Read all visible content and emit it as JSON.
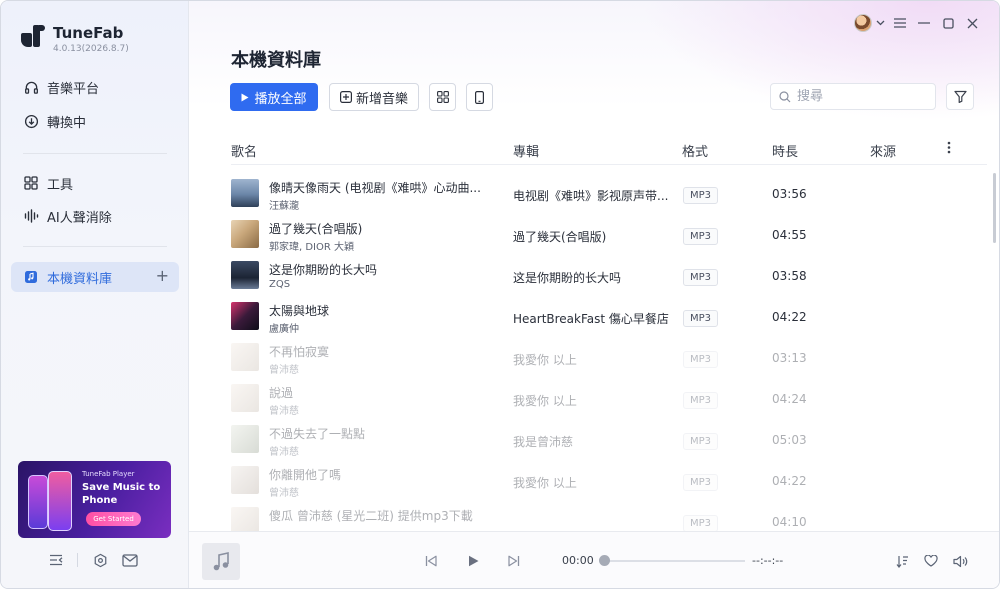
{
  "app": {
    "name": "TuneFab",
    "version": "4.0.13(2026.8.7)"
  },
  "sidebar": {
    "items": [
      {
        "label": "音樂平台",
        "icon": "headphones-icon"
      },
      {
        "label": "轉換中",
        "icon": "download-circle-icon"
      },
      {
        "label": "工具",
        "icon": "grid-icon"
      },
      {
        "label": "AI人聲消除",
        "icon": "waveform-icon"
      },
      {
        "label": "本機資料庫",
        "icon": "music-file-icon",
        "active": true
      }
    ],
    "promo": {
      "subtitle": "TuneFab Player",
      "title": "Save Music to Phone",
      "button": "Get Started"
    }
  },
  "main": {
    "title": "本機資料庫",
    "toolbar": {
      "play_all": "播放全部",
      "add_music": "新增音樂",
      "search_placeholder": "搜尋"
    },
    "columns": {
      "name": "歌名",
      "album": "專輯",
      "format": "格式",
      "duration": "時長",
      "source": "來源"
    },
    "tracks": [
      {
        "title": "像晴天像雨天 (电视剧《难哄》心动曲...",
        "artist": "汪蘇瀧",
        "album": "电视剧《难哄》影视原声带...",
        "format": "MP3",
        "duration": "03:56",
        "dim": false
      },
      {
        "title": "過了幾天(合唱版)",
        "artist": "郭家瑋, DIOR 大穎",
        "album": "過了幾天(合唱版)",
        "format": "MP3",
        "duration": "04:55",
        "dim": false
      },
      {
        "title": "这是你期盼的长大吗",
        "artist": "ZQS",
        "album": "这是你期盼的长大吗",
        "format": "MP3",
        "duration": "03:58",
        "dim": false
      },
      {
        "title": "太陽與地球",
        "artist": "盧廣仲",
        "album": "HeartBreakFast 傷心早餐店",
        "format": "MP3",
        "duration": "04:22",
        "dim": false
      },
      {
        "title": "不再怕寂寞",
        "artist": "曾沛慈",
        "album": "我愛你 以上",
        "format": "MP3",
        "duration": "03:13",
        "dim": true
      },
      {
        "title": "說過",
        "artist": "曾沛慈",
        "album": "我愛你 以上",
        "format": "MP3",
        "duration": "04:24",
        "dim": true
      },
      {
        "title": "不過失去了一點點",
        "artist": "曾沛慈",
        "album": "我是曾沛慈",
        "format": "MP3",
        "duration": "05:03",
        "dim": true
      },
      {
        "title": "你離開他了嗎",
        "artist": "曾沛慈",
        "album": "我愛你 以上",
        "format": "MP3",
        "duration": "04:22",
        "dim": true
      },
      {
        "title": "傻瓜 曾沛慈 (星光二班) 提供mp3下載",
        "artist": "",
        "album": "",
        "format": "MP3",
        "duration": "04:10",
        "dim": true
      }
    ]
  },
  "player": {
    "current_time": "00:00",
    "total_time": "--:--:--",
    "progress": 0
  },
  "colors": {
    "accent": "#2f6bf0",
    "active_nav_bg": "#dde5f7"
  }
}
